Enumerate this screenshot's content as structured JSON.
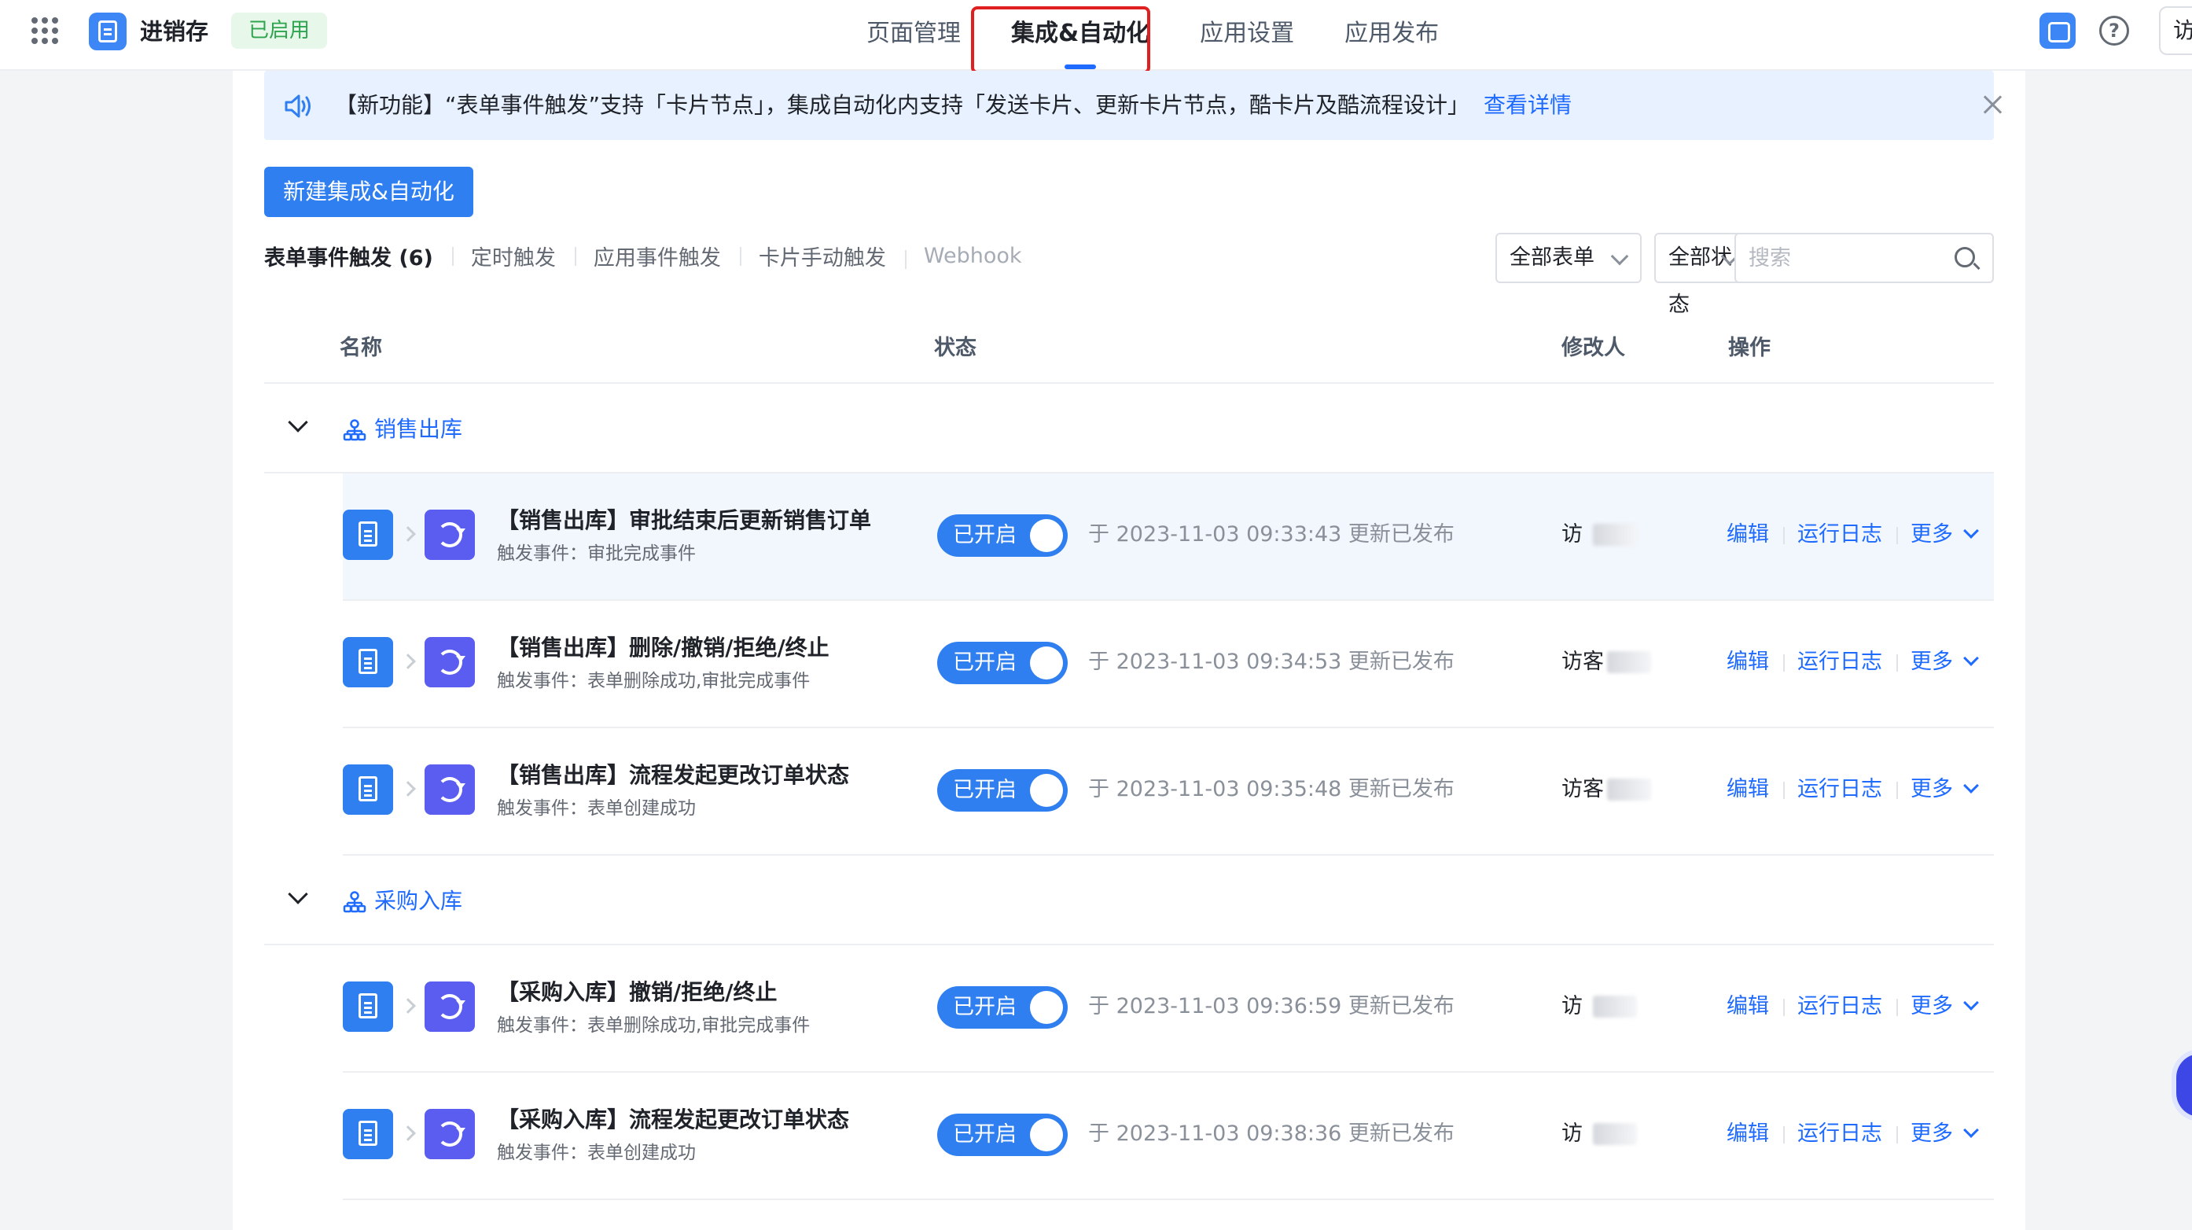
{
  "header": {
    "app_name": "进销存",
    "app_status": "已启用",
    "tabs": [
      {
        "label": "页面管理"
      },
      {
        "label": "集成&自动化"
      },
      {
        "label": "应用设置"
      },
      {
        "label": "应用发布"
      }
    ],
    "active_tab": "集成&自动化",
    "visitor_label": "访"
  },
  "notice": {
    "text": "【新功能】“表单事件触发”支持「卡片节点」，集成自动化内支持「发送卡片、更新卡片节点，酷卡片及酷流程设计」",
    "link": "查看详情"
  },
  "toolbar": {
    "new_button": "新建集成&自动化",
    "subtabs": [
      {
        "label": "表单事件触发 (6)"
      },
      {
        "label": "定时触发"
      },
      {
        "label": "应用事件触发"
      },
      {
        "label": "卡片手动触发"
      },
      {
        "label": "Webhook"
      }
    ],
    "form_filter": "全部表单",
    "status_filter": "全部状态",
    "search_placeholder": "搜索"
  },
  "table": {
    "columns": {
      "name": "名称",
      "status": "状态",
      "editor": "修改人",
      "actions": "操作"
    },
    "groups": [
      {
        "title": "销售出库",
        "rows": [
          {
            "title": "【销售出库】审批结束后更新销售订单",
            "trigger": "触发事件：审批完成事件",
            "status": "已开启",
            "time": "于 2023-11-03 09:33:43 更新已发布",
            "editor": "访"
          },
          {
            "title": "【销售出库】删除/撤销/拒绝/终止",
            "trigger": "触发事件：表单删除成功,审批完成事件",
            "status": "已开启",
            "time": "于 2023-11-03 09:34:53 更新已发布",
            "editor": "访客"
          },
          {
            "title": "【销售出库】流程发起更改订单状态",
            "trigger": "触发事件：表单创建成功",
            "status": "已开启",
            "time": "于 2023-11-03 09:35:48 更新已发布",
            "editor": "访客"
          }
        ]
      },
      {
        "title": "采购入库",
        "rows": [
          {
            "title": "【采购入库】撤销/拒绝/终止",
            "trigger": "触发事件：表单删除成功,审批完成事件",
            "status": "已开启",
            "time": "于 2023-11-03 09:36:59 更新已发布",
            "editor": "访"
          },
          {
            "title": "【采购入库】流程发起更改订单状态",
            "trigger": "触发事件：表单创建成功",
            "status": "已开启",
            "time": "于 2023-11-03 09:38:36 更新已发布",
            "editor": "访"
          }
        ]
      }
    ],
    "actions": {
      "edit": "编辑",
      "logs": "运行日志",
      "more": "更多"
    }
  },
  "colors": {
    "primary": "#2f7ff0",
    "link": "#1f6bff",
    "sync_icon": "#5b5cf0",
    "highlight": "#e02020",
    "status_green": "#2ea44f"
  }
}
